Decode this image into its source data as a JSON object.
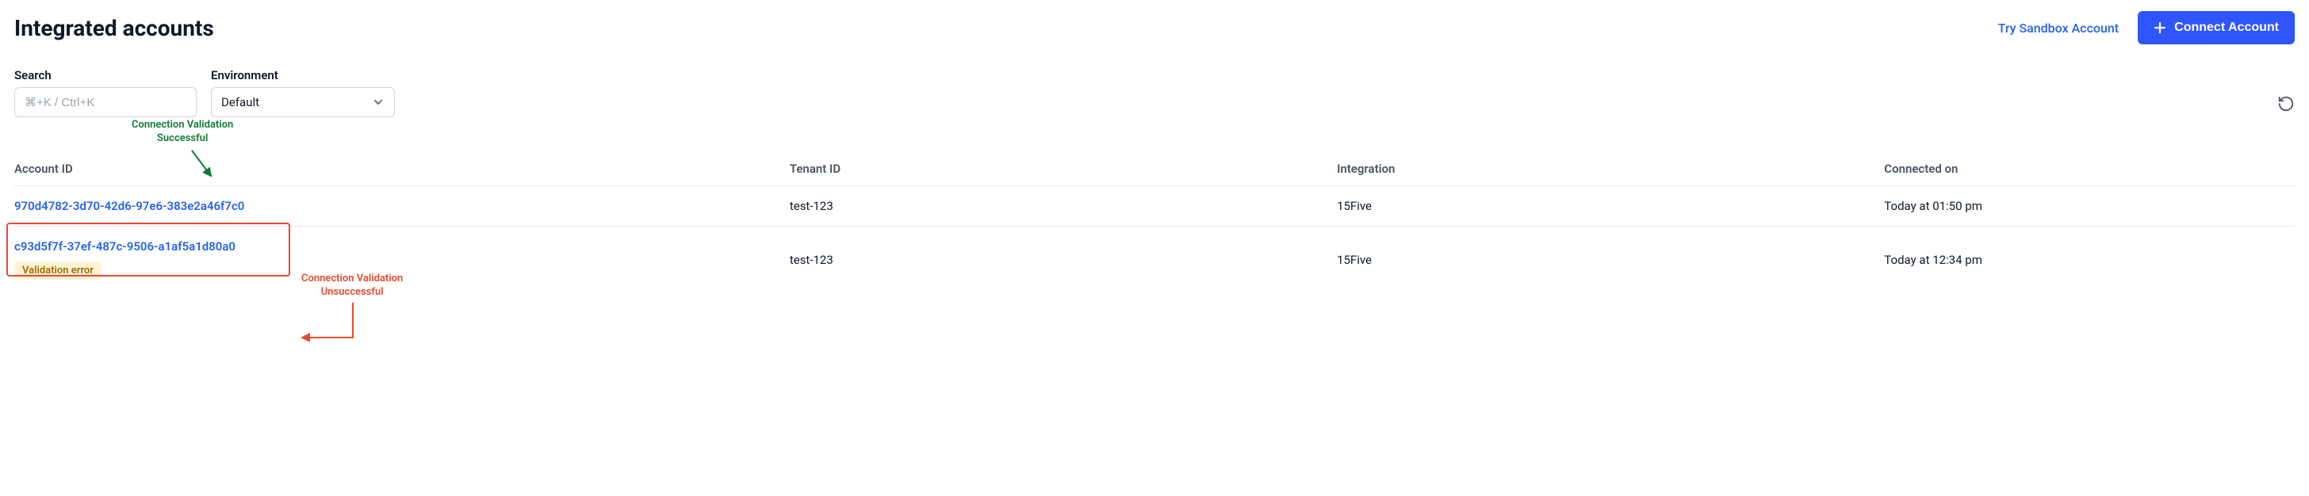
{
  "header": {
    "title": "Integrated accounts",
    "sandbox_link": "Try Sandbox Account",
    "connect_button": "Connect Account"
  },
  "filters": {
    "search_label": "Search",
    "search_placeholder": "⌘+K / Ctrl+K",
    "env_label": "Environment",
    "env_value": "Default"
  },
  "annotations": {
    "success_line1": "Connection Validation",
    "success_line2": "Successful",
    "fail_line1": "Connection Validation",
    "fail_line2": "Unsuccessful"
  },
  "table": {
    "columns": {
      "account_id": "Account ID",
      "tenant_id": "Tenant ID",
      "integration": "Integration",
      "connected_on": "Connected on"
    },
    "rows": [
      {
        "account_id": "970d4782-3d70-42d6-97e6-383e2a46f7c0",
        "tenant_id": "test-123",
        "integration": "15Five",
        "connected_on": "Today at 01:50 pm"
      },
      {
        "account_id": "c93d5f7f-37ef-487c-9506-a1af5a1d80a0",
        "tenant_id": "test-123",
        "integration": "15Five",
        "connected_on": "Today at 12:34 pm",
        "error_badge": "Validation error"
      }
    ]
  }
}
